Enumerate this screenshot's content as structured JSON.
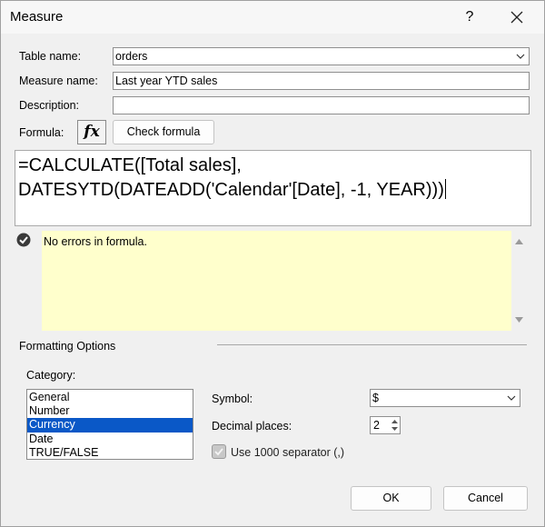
{
  "window": {
    "title": "Measure",
    "help_label": "?"
  },
  "labels": {
    "table_name": "Table name:",
    "measure_name": "Measure name:",
    "description": "Description:",
    "formula": "Formula:"
  },
  "fields": {
    "table_name_value": "orders",
    "measure_name_value": "Last year YTD sales",
    "description_value": ""
  },
  "formula_bar": {
    "fx_label": "fx",
    "check_formula_label": "Check formula",
    "formula_line1": "=CALCULATE([Total sales],",
    "formula_line2": "DATESYTD(DATEADD('Calendar'[Date], -1, YEAR)))"
  },
  "status": {
    "message": "No errors in formula."
  },
  "formatting": {
    "heading": "Formatting Options",
    "category_label": "Category:",
    "categories": [
      "General",
      "Number",
      "Currency",
      "Date",
      "TRUE/FALSE"
    ],
    "selected_category": "Currency",
    "symbol_label": "Symbol:",
    "symbol_value": "$",
    "decimal_label": "Decimal places:",
    "decimal_value": "2",
    "separator_label": "Use 1000 separator (,)"
  },
  "buttons": {
    "ok": "OK",
    "cancel": "Cancel"
  },
  "colors": {
    "selection": "#0a58c7",
    "message_bg": "#ffffcc"
  }
}
